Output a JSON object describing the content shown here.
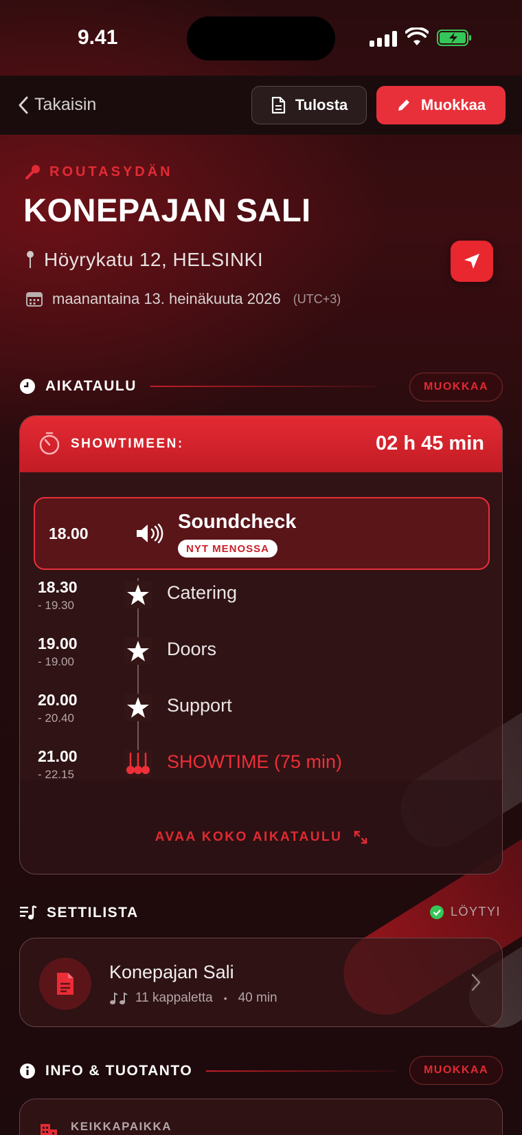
{
  "status_bar": {
    "time": "9.41"
  },
  "nav": {
    "back_label": "Takaisin",
    "print_label": "Tulosta",
    "edit_label": "Muokkaa"
  },
  "gig": {
    "band": "ROUTASYDÄN",
    "venue": "KONEPAJAN SALI",
    "address": "Höyrykatu 12, HELSINKI",
    "date": "maanantaina 13. heinäkuuta 2026",
    "timezone": "(UTC+3)"
  },
  "schedule": {
    "heading": "AIKATAULU",
    "edit_label": "MUOKKAA",
    "countdown_label": "SHOWTIMEEN:",
    "countdown_value": "02 h 45 min",
    "current": {
      "time": "18.00",
      "title": "Soundcheck",
      "badge": "NYT MENOSSA",
      "icon": "speaker-icon"
    },
    "items": [
      {
        "start": "18.30",
        "end": "- 19.30",
        "title": "Catering",
        "icon": "star-icon"
      },
      {
        "start": "19.00",
        "end": "- 19.00",
        "title": "Doors",
        "icon": "star-icon"
      },
      {
        "start": "20.00",
        "end": "- 20.40",
        "title": "Support",
        "icon": "star-icon"
      },
      {
        "start": "21.00",
        "end": "- 22.15",
        "title": "SHOWTIME (75 min)",
        "icon": "guitars-icon"
      }
    ],
    "open_full_label": "AVAA KOKO AIKATAULU"
  },
  "setlist": {
    "heading": "SETTILISTA",
    "status": "LÖYTYI",
    "title": "Konepajan Sali",
    "songs": "11 kappaletta",
    "separator": "•",
    "duration": "40 min"
  },
  "info": {
    "heading": "INFO & TUOTANTO",
    "edit_label": "MUOKKAA",
    "venue_label": "KEIKKAPAIKKA"
  },
  "colors": {
    "accent": "#e8303b",
    "background": "#1c0b0c",
    "card": "#341617"
  }
}
